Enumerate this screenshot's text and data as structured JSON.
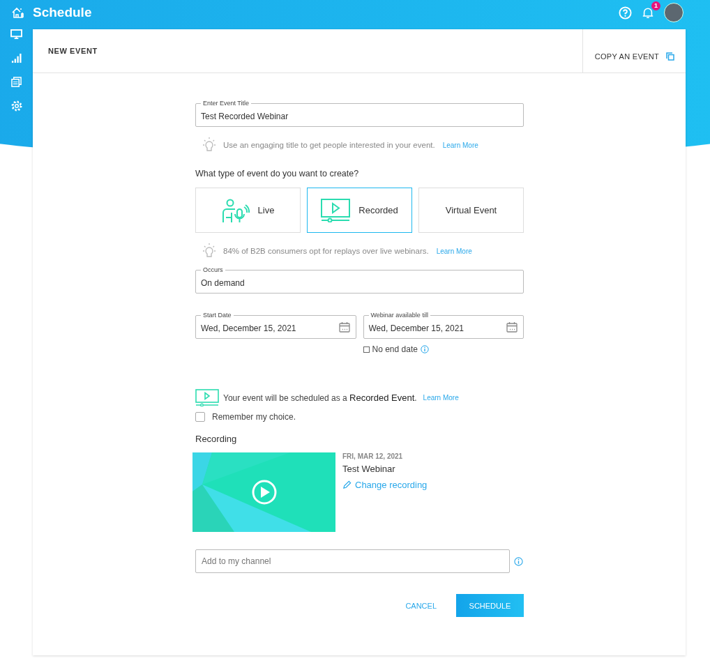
{
  "header": {
    "title": "Schedule",
    "notification_count": "1"
  },
  "card": {
    "title": "NEW EVENT",
    "copy_action": "COPY AN EVENT"
  },
  "title_field": {
    "label": "Enter Event Title",
    "value": "Test Recorded Webinar"
  },
  "title_tip": {
    "text": "Use an engaging title to get people interested in your event.",
    "link": "Learn More"
  },
  "event_type": {
    "question": "What type of event do you want to create?",
    "options": [
      {
        "kind": "live",
        "label": "Live",
        "selected": false
      },
      {
        "kind": "recorded",
        "label": "Recorded",
        "selected": true
      },
      {
        "kind": "virtual",
        "label": "Virtual Event",
        "selected": false
      }
    ]
  },
  "type_tip": {
    "text": "84% of B2B consumers opt for replays over live webinars.",
    "link": "Learn More"
  },
  "occurs": {
    "label": "Occurs",
    "value": "On demand"
  },
  "start_date": {
    "label": "Start Date",
    "value": "Wed, December 15, 2021"
  },
  "end_date": {
    "label": "Webinar available till",
    "value": "Wed, December 15, 2021"
  },
  "no_end_date": {
    "label": "No end date",
    "checked": false
  },
  "schedule_note": {
    "text": "Your event will be scheduled as a **Recorded Event**.",
    "link": "Learn More"
  },
  "remember": {
    "label": "Remember my choice.",
    "checked": false
  },
  "recording": {
    "heading": "Recording",
    "date": "FRI, MAR 12, 2021",
    "title": "Test Webinar",
    "change": "Change recording"
  },
  "channel": {
    "placeholder": "Add to my channel"
  },
  "buttons": {
    "cancel": "CANCEL",
    "schedule": "SCHEDULE"
  }
}
